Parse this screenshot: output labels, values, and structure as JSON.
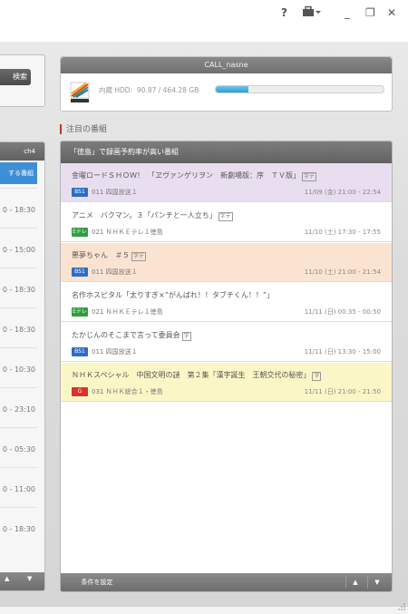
{
  "titlebar": {
    "help": "?",
    "toolbox_icon": "toolbox-icon",
    "minimize": "_",
    "restore": "❐",
    "close": "✕"
  },
  "left_panel": {
    "search_label": "検索",
    "header_ch": "ch4",
    "header_sub": "する番組",
    "times": [
      "0 - 18:30",
      "0 - 15:00",
      "0 - 18:30",
      "0 - 18:30",
      "0 - 10:30",
      "0 - 23:10",
      "0 - 05:30",
      "0 - 11:00",
      "0 - 18:30"
    ]
  },
  "nasne": {
    "name": "CALL_nasne",
    "hdd_label": "内蔵 HDD:",
    "hdd_usage": "90.87 / 464.28 GB",
    "hdd_ratio": 0.196
  },
  "section": {
    "title": "注目の番組"
  },
  "programs_panel": {
    "header": "「徳島」で録画予約率が高い番組",
    "condition_button": "条件を設定",
    "rows": [
      {
        "title": "金曜ロードＳＨＯＷ！　「ヱヴァンゲリヲン　新劇場版：序　ＴＶ版」",
        "badge": "字デ",
        "ch_icon": "BS1",
        "ch": "011  四国放送１",
        "time": "11/09 (金) 21:00 - 22:54",
        "bg": "#e8def0",
        "icon_color": "#2b6cc4"
      },
      {
        "title": "アニメ　バクマン。３「パンチと一人立ち」",
        "badge": "字デ",
        "ch_icon": "Eテレ",
        "ch": "021  ＮＨＫＥテレ１徳島",
        "time": "11/10 (土) 17:30 - 17:55",
        "bg": "#ffffff",
        "icon_color": "#2e9e3e"
      },
      {
        "title": "悪夢ちゃん　＃５",
        "badge": "字デ",
        "ch_icon": "BS1",
        "ch": "011  四国放送１",
        "time": "11/10 (土) 21:00 - 21:54",
        "bg": "#fbe3d2",
        "icon_color": "#2b6cc4"
      },
      {
        "title": "名作ホスピタル「太りすぎ×”がんばれ！！タブチくん！！”」",
        "badge": "",
        "ch_icon": "Eテレ",
        "ch": "021  ＮＨＫＥテレ１徳島",
        "time": "11/11 (日) 00:35 - 00:50",
        "bg": "#ffffff",
        "icon_color": "#2e9e3e"
      },
      {
        "title": "たかじんのそこまで言って委員会",
        "badge": "字",
        "ch_icon": "BS1",
        "ch": "011  四国放送１",
        "time": "11/11 (日) 13:30 - 15:00",
        "bg": "#ffffff",
        "icon_color": "#2b6cc4"
      },
      {
        "title": "ＮＨＫスペシャル　中国文明の謎　第２集「漢字誕生　王朝交代の秘密」",
        "badge": "字",
        "ch_icon": "G",
        "ch": "031  ＮＨＫ総合１・徳島",
        "time": "11/11 (日) 21:00 - 21:50",
        "bg": "#fbf6c6",
        "icon_color": "#d8322f"
      }
    ]
  },
  "colors": {
    "accent": "#c0392b",
    "hdd_fill": "#2f9ed4"
  }
}
